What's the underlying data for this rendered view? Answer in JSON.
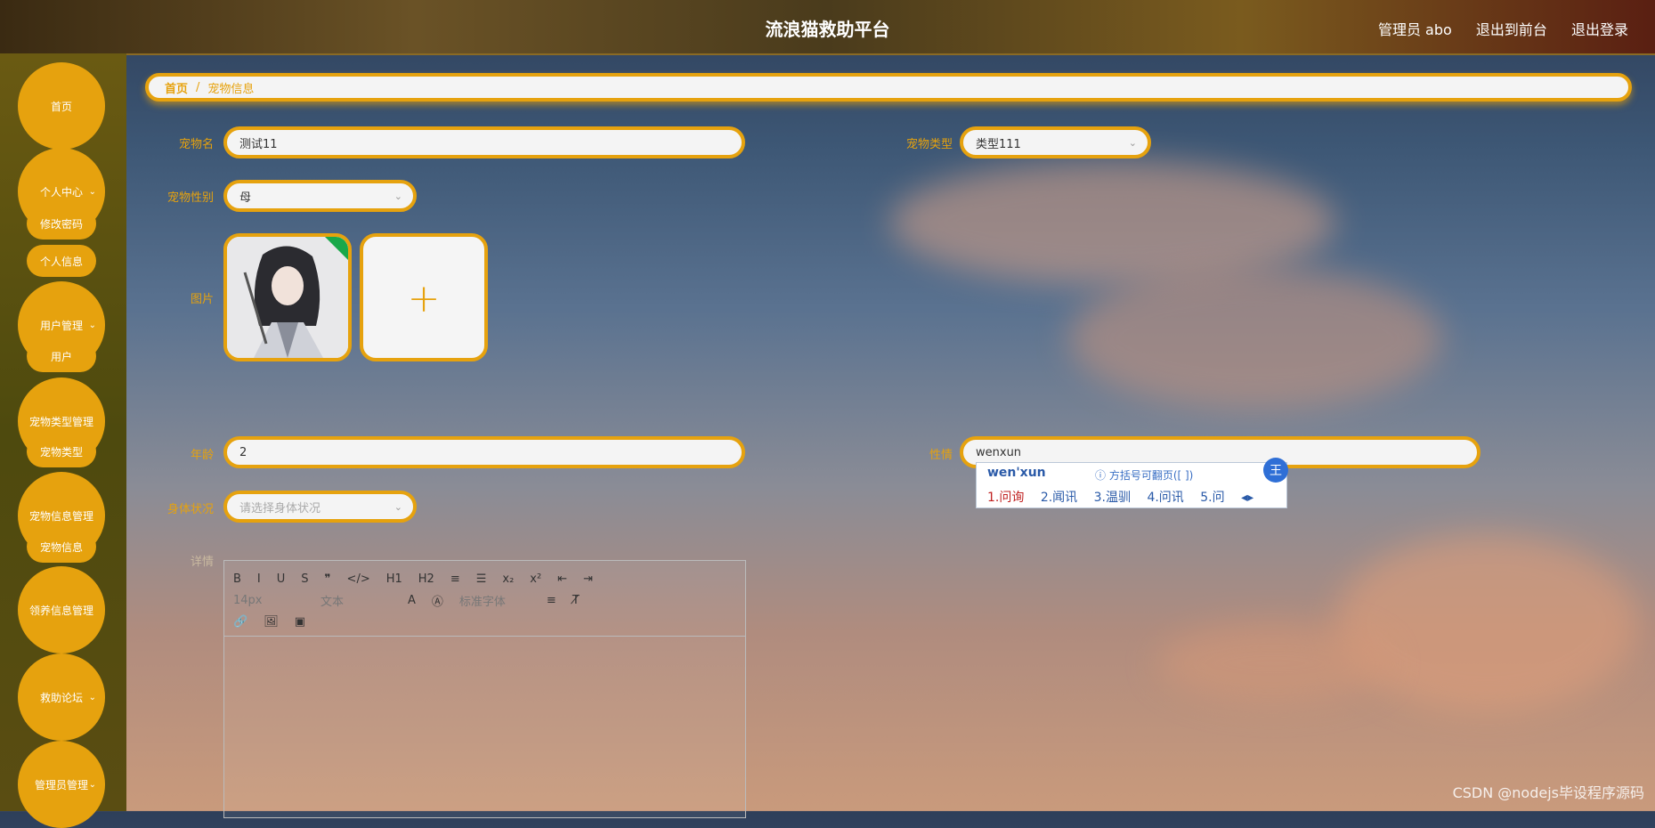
{
  "header": {
    "title": "流浪猫救助平台",
    "user": "管理员 abo",
    "back_front": "退出到前台",
    "logout": "退出登录"
  },
  "sidebar": {
    "home": "首页",
    "personal": "个人中心",
    "change_pwd": "修改密码",
    "personal_info": "个人信息",
    "user_mgmt": "用户管理",
    "user": "用户",
    "pet_type_mgmt": "宠物类型管理",
    "pet_type": "宠物类型",
    "pet_info_mgmt": "宠物信息管理",
    "pet_info": "宠物信息",
    "adopt_mgmt": "领养信息管理",
    "forum": "救助论坛",
    "admin_mgmt": "管理员管理"
  },
  "breadcrumb": {
    "home": "首页",
    "sep": "/",
    "current": "宠物信息"
  },
  "form": {
    "pet_name_label": "宠物名",
    "pet_name_value": "测试11",
    "pet_type_label": "宠物类型",
    "pet_type_value": "类型111",
    "pet_gender_label": "宠物性别",
    "pet_gender_value": "母",
    "image_label": "图片",
    "image_add": "+",
    "age_label": "年龄",
    "age_value": "2",
    "temper_label": "性情",
    "temper_value": "wenxun",
    "health_label": "身体状况",
    "health_placeholder": "请选择身体状况",
    "detail_label": "详情"
  },
  "editor": {
    "row1": [
      "B",
      "I",
      "U",
      "S",
      "❞",
      "</>",
      "H1",
      "H2",
      "≡",
      "☰",
      "x₂",
      "x²",
      "⇤",
      "⇥"
    ],
    "size": "14px",
    "format": "文本",
    "font": "标准字体",
    "row3": [
      "🔗",
      "🖼",
      "▣"
    ]
  },
  "ime": {
    "pinyin": "wen'xun",
    "tip": "ⓘ 方括号可翻页([ ])",
    "c1": "1.问询",
    "c2": "2.闻讯",
    "c3": "3.温驯",
    "c4": "4.问讯",
    "c5": "5.问",
    "badge": "王"
  },
  "watermark": "CSDN @nodejs毕设程序源码"
}
